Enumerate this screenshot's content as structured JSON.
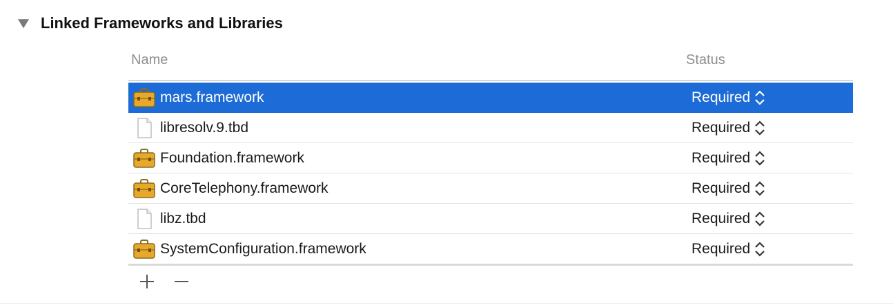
{
  "section": {
    "title": "Linked Frameworks and Libraries",
    "expanded": true
  },
  "table": {
    "columns": {
      "name": "Name",
      "status": "Status"
    },
    "rows": [
      {
        "name": "mars.framework",
        "status": "Required",
        "icon": "briefcase-icon",
        "selected": true
      },
      {
        "name": "libresolv.9.tbd",
        "status": "Required",
        "icon": "document-icon",
        "selected": false
      },
      {
        "name": "Foundation.framework",
        "status": "Required",
        "icon": "briefcase-icon",
        "selected": false
      },
      {
        "name": "CoreTelephony.framework",
        "status": "Required",
        "icon": "briefcase-icon",
        "selected": false
      },
      {
        "name": "libz.tbd",
        "status": "Required",
        "icon": "document-icon",
        "selected": false
      },
      {
        "name": "SystemConfiguration.framework",
        "status": "Required",
        "icon": "briefcase-icon",
        "selected": false
      }
    ]
  },
  "colors": {
    "selection": "#1d6bd6",
    "header_text": "#8e8e8e",
    "briefcase": "#e8a92a"
  }
}
